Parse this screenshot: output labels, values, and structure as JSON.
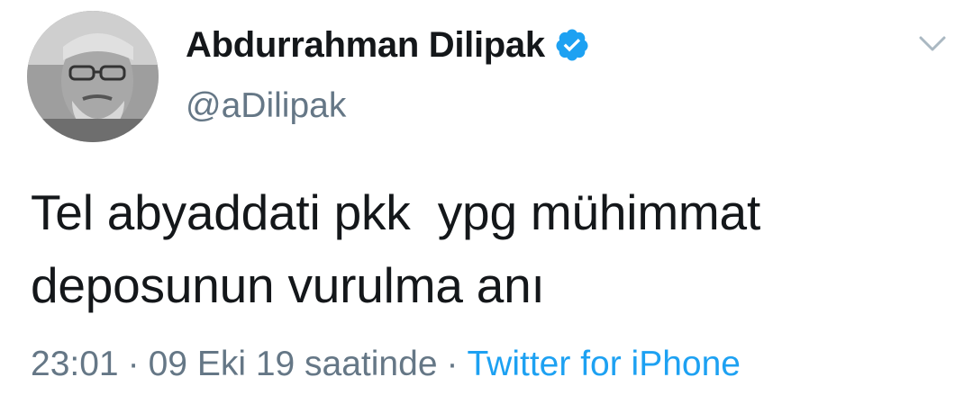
{
  "author": {
    "display_name": "Abdurrahman Dilipak",
    "handle": "@aDilipak",
    "verified": true,
    "avatar_icon": "user-photo-avatar"
  },
  "menu": {
    "caret_icon": "chevron-down-icon"
  },
  "tweet": {
    "text": "Tel abyaddati pkk  ypg mühimmat deposunun vurulma anı"
  },
  "meta": {
    "time": "23:01",
    "date": "09 Eki 19 saatinde",
    "separator": "·",
    "source": "Twitter for iPhone"
  },
  "colors": {
    "primary_text": "#14171a",
    "secondary_text": "#657786",
    "link": "#1da1f2",
    "verified_badge": "#1da1f2",
    "background": "#ffffff"
  }
}
